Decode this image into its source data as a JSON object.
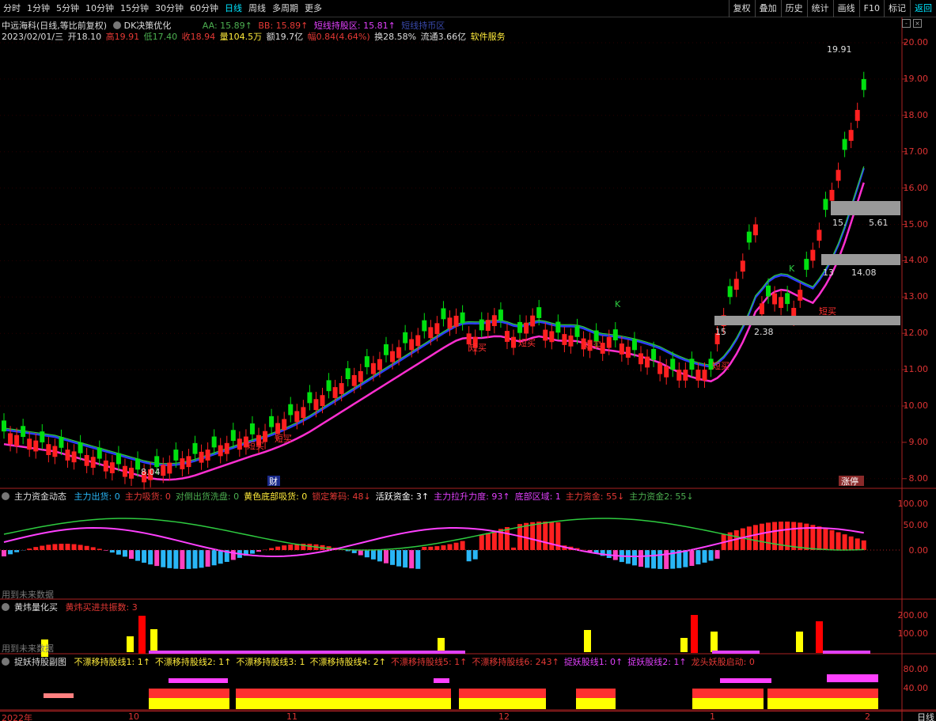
{
  "toolbar": {
    "periods": [
      "分时",
      "1分钟",
      "5分钟",
      "10分钟",
      "15分钟",
      "30分钟",
      "60分钟",
      "日线",
      "周线",
      "多周期",
      "更多"
    ],
    "active_period": "日线",
    "right_buttons": [
      "复权",
      "叠加",
      "历史",
      "统计",
      "画线",
      "F10",
      "标记",
      "返回"
    ]
  },
  "stock": {
    "name_line": "中远海科(日线,等比前复权)",
    "indicator_name": "DK决策优化",
    "aa": "AA: 15.89↑",
    "bb": "BB: 15.89↑",
    "short_hold": "短线持股区: 15.81↑",
    "short_sell": "短线持币区",
    "date": "2023/02/01/三",
    "open": "开18.10",
    "high": "高19.91",
    "low": "低17.40",
    "close": "收18.94",
    "volume": "量104.5万",
    "amount": "额19.7亿",
    "change": "幅0.84(4.64%)",
    "turnover": "换28.58%",
    "float": "流通3.66亿",
    "service": "软件服务"
  },
  "price_axis": [
    "20.00",
    "19.00",
    "18.00",
    "17.00",
    "16.00",
    "15.00",
    "14.00",
    "13.00",
    "12.00",
    "11.00",
    "10.00",
    "9.00",
    "8.00"
  ],
  "annotations": {
    "high_label": "19.91",
    "low_label": "8.04",
    "zone_labels": [
      "15.",
      "5.61",
      "13",
      "14.08",
      "15",
      "2.38"
    ],
    "signals": [
      "短买",
      "短买",
      "短买",
      "短买",
      "短买",
      "短买",
      "短买"
    ],
    "k_label": "K",
    "cai": "财",
    "zhangting": "涨停"
  },
  "panel1": {
    "title": "主力资金动态",
    "items": [
      {
        "text": "主力出货: 0",
        "color": "#29b6f6"
      },
      {
        "text": "主力吸货: 0",
        "color": "#e53935"
      },
      {
        "text": "对倒出货洗盘: 0",
        "color": "#4caf50"
      },
      {
        "text": "黄色底部吸货: 0",
        "color": "#ffeb3b"
      },
      {
        "text": "锁定筹码: 48↓",
        "color": "#e53935"
      },
      {
        "text": "活跃资金: 3↑",
        "color": "#ffffff"
      },
      {
        "text": "主力拉升力度: 93↑",
        "color": "#e040fb"
      },
      {
        "text": "底部区域: 1",
        "color": "#e040fb"
      },
      {
        "text": "主力资金: 55↓",
        "color": "#e53935"
      },
      {
        "text": "主力资金2: 55↓",
        "color": "#4caf50"
      }
    ],
    "axis": [
      "100.00",
      "50.00",
      "0.00"
    ],
    "note": "用到未来数据"
  },
  "panel2": {
    "title": "黄炜量化买",
    "items": [
      {
        "text": "黄炜买进共振数: 3",
        "color": "#e53935"
      }
    ],
    "axis": [
      "200.00",
      "100.00"
    ],
    "note": "用到未来数据"
  },
  "panel3": {
    "title": "捉妖持股副图",
    "items": [
      {
        "text": "不漂移持股线1: 1↑",
        "color": "#ffeb3b"
      },
      {
        "text": "不漂移持股线2: 1↑",
        "color": "#ffeb3b"
      },
      {
        "text": "不漂移持股线3: 1",
        "color": "#ffeb3b"
      },
      {
        "text": "不漂移持股线4: 2↑",
        "color": "#ffeb3b"
      },
      {
        "text": "不漂移持股线5: 1↑",
        "color": "#e53935"
      },
      {
        "text": "不漂移持股线6: 243↑",
        "color": "#e53935"
      },
      {
        "text": "捉妖股线1: 0↑",
        "color": "#e040fb"
      },
      {
        "text": "捉妖股线2: 1↑",
        "color": "#e040fb"
      },
      {
        "text": "龙头妖股启动: 0",
        "color": "#e53935"
      }
    ],
    "axis": [
      "80.00",
      "40.00"
    ]
  },
  "date_axis": [
    "2022年",
    "10",
    "11",
    "12",
    "1",
    "2"
  ],
  "corner_label": "日线"
}
